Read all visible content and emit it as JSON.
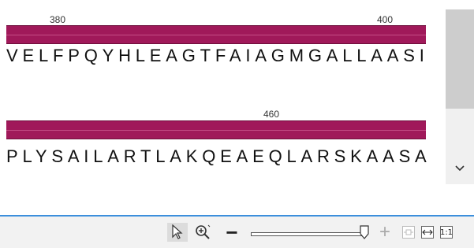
{
  "ruler": {
    "row1": {
      "tick_a": "380",
      "tick_b": "400"
    },
    "row2": {
      "tick_a": "460"
    }
  },
  "sequence": {
    "row1": "VELFPQYHLEAGTFAIAGMGALLAASI",
    "row2": "PLYSAILARTLAKQEAEQLARSKAASA"
  },
  "colors": {
    "track": "#a0195a",
    "accent": "#3c8fdc"
  },
  "toolbar": {
    "select_icon": "cursor-arrow-icon",
    "zoom_icon": "zoom-in-icon",
    "zoom_out_label": "−",
    "zoom_in_label": "+",
    "fit_label": "1:1"
  },
  "icons": {
    "scroll_down": "chevron-down-icon",
    "fit_width": "fit-width-icon",
    "fit_window": "fit-window-icon"
  }
}
